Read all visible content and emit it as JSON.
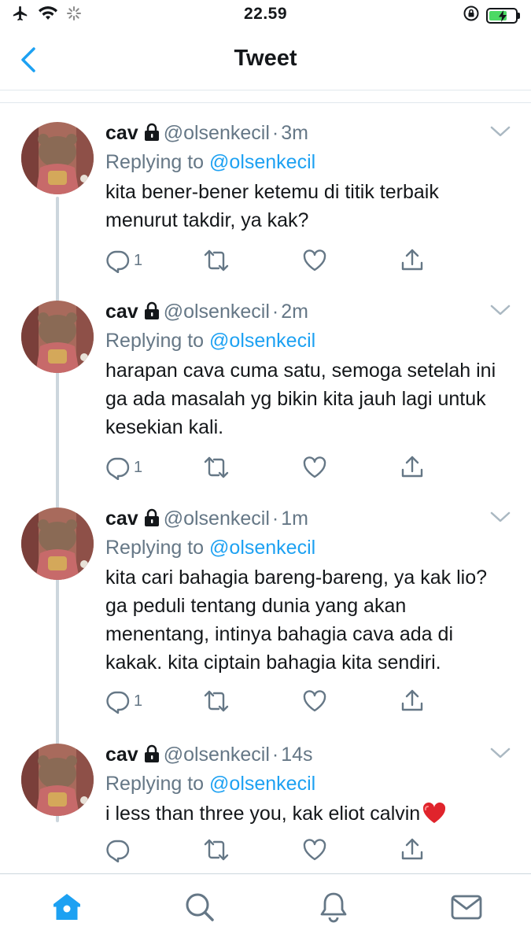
{
  "status_bar": {
    "time": "22.59",
    "icons": [
      "airplane-icon",
      "wifi-icon",
      "activity-spinner-icon",
      "orientation-lock-icon",
      "battery-charging-icon"
    ]
  },
  "header": {
    "title": "Tweet",
    "back_icon": "chevron-left-icon"
  },
  "colors": {
    "accent": "#1da1f2",
    "text": "#14171a",
    "muted": "#657786",
    "line": "#ccd6dd"
  },
  "tweets": [
    {
      "name": "cav",
      "handle": "@olsenkecil",
      "dot": "·",
      "time": "3m",
      "replying_label": "Replying to",
      "replying_to": "@olsenkecil",
      "text": "kita bener-bener ketemu di titik terbaik menurut takdir, ya kak?",
      "reply_count": "1"
    },
    {
      "name": "cav",
      "handle": "@olsenkecil",
      "dot": "·",
      "time": "2m",
      "replying_label": "Replying to",
      "replying_to": "@olsenkecil",
      "text": "harapan cava cuma satu, semoga setelah ini ga ada masalah yg bikin kita jauh lagi untuk kesekian kali.",
      "reply_count": "1"
    },
    {
      "name": "cav",
      "handle": "@olsenkecil",
      "dot": "·",
      "time": "1m",
      "replying_label": "Replying to",
      "replying_to": "@olsenkecil",
      "text": "kita cari bahagia bareng-bareng, ya kak lio? ga peduli tentang dunia yang akan menentang, intinya bahagia cava ada di kakak. kita ciptain bahagia kita sendiri.",
      "reply_count": "1"
    },
    {
      "name": "cav",
      "handle": "@olsenkecil",
      "dot": "·",
      "time": "14s",
      "replying_label": "Replying to",
      "replying_to": "@olsenkecil",
      "text": "i less than three you, kak eliot calvin",
      "reply_count": ""
    }
  ],
  "tab_bar": {
    "tabs": [
      "home-icon",
      "search-icon",
      "notifications-icon",
      "messages-icon"
    ],
    "active": "home-icon"
  }
}
